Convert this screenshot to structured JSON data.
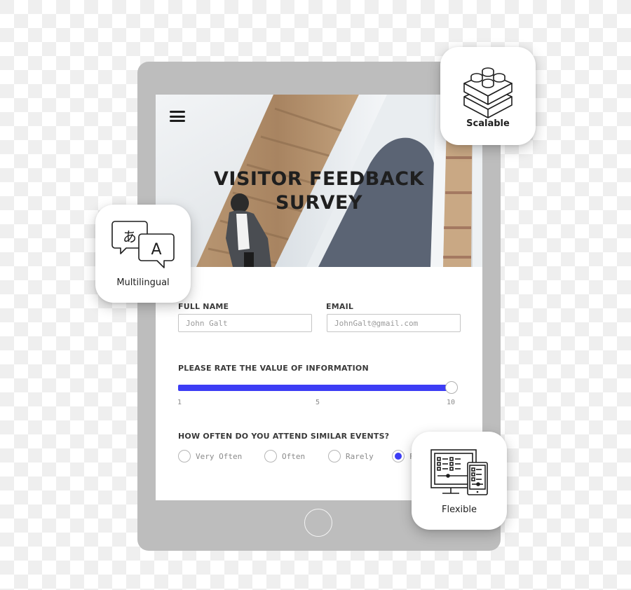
{
  "survey": {
    "menu_icon": "hamburger-menu-icon",
    "title_line1": "VISITOR FEEDBACK",
    "title_line2": "SURVEY",
    "full_name": {
      "label": "FULL NAME",
      "placeholder": "John Galt"
    },
    "email": {
      "label": "EMAIL",
      "placeholder": "JohnGalt@gmail.com"
    },
    "rating": {
      "label": "PLEASE RATE THE VALUE OF INFORMATION",
      "min": 1,
      "max": 10,
      "value": 10,
      "ticks": [
        "1",
        "5",
        "10"
      ]
    },
    "attendance": {
      "label": "HOW OFTEN DO YOU ATTEND SIMILAR EVENTS?",
      "options": [
        {
          "label": "Very Often",
          "checked": false
        },
        {
          "label": "Often",
          "checked": false
        },
        {
          "label": "Rarely",
          "checked": false
        },
        {
          "label": "F",
          "checked": true
        }
      ]
    }
  },
  "features": [
    {
      "label": "Scalable",
      "icon": "lego-bricks-icon"
    },
    {
      "label": "Multilingual",
      "icon": "translation-bubbles-icon"
    },
    {
      "label": "Flexible",
      "icon": "responsive-devices-icon"
    }
  ],
  "colors": {
    "accent": "#3d3df5",
    "tablet_frame": "#bdbdbd",
    "text_dark": "#1f1f1f"
  }
}
